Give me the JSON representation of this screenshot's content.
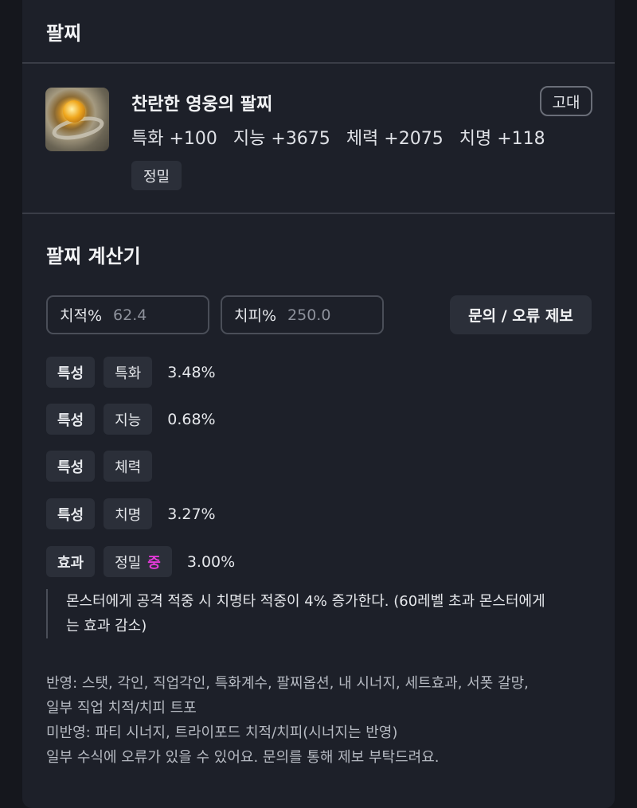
{
  "header": {
    "title": "팔찌"
  },
  "item": {
    "name": "찬란한 영웅의 팔찌",
    "grade": "고대",
    "stats": [
      "특화 +100",
      "지능 +3675",
      "체력 +2075",
      "치명 +118"
    ],
    "effect": "정밀",
    "icon": "bracelet-item-icon"
  },
  "calculator": {
    "title": "팔찌 계산기",
    "crit_rate_label": "치적%",
    "crit_rate_placeholder": "62.4",
    "crit_damage_label": "치피%",
    "crit_damage_placeholder": "250.0",
    "report_button": "문의 / 오류 제보",
    "rows": [
      {
        "type": "특성",
        "stat": "특화",
        "value": "3.48%"
      },
      {
        "type": "특성",
        "stat": "지능",
        "value": "0.68%"
      },
      {
        "type": "특성",
        "stat": "체력",
        "value": ""
      },
      {
        "type": "특성",
        "stat": "치명",
        "value": "3.27%"
      },
      {
        "type": "효과",
        "stat": "정밀",
        "level": "중",
        "value": "3.00%"
      }
    ],
    "effect_description": "몬스터에게 공격 적중 시 치명타 적중이 4% 증가한다. (60레벨 초과 몬스터에게는 효과 감소)",
    "notes": [
      "반영: 스탯, 각인, 직업각인, 특화계수, 팔찌옵션, 내 시너지, 세트효과, 서폿 갈망,",
      "일부 직업 치적/치피 트포",
      "미반영: 파티 시너지, 트라이포드 치적/치피(시너지는 반영)",
      "일부 수식에 오류가 있을 수 있어요. 문의를 통해 제보 부탁드려요."
    ]
  },
  "colors": {
    "background": "#15171d",
    "panel": "#1d2029",
    "chip": "#2b2f39",
    "level_accent": "#e23ad8"
  }
}
